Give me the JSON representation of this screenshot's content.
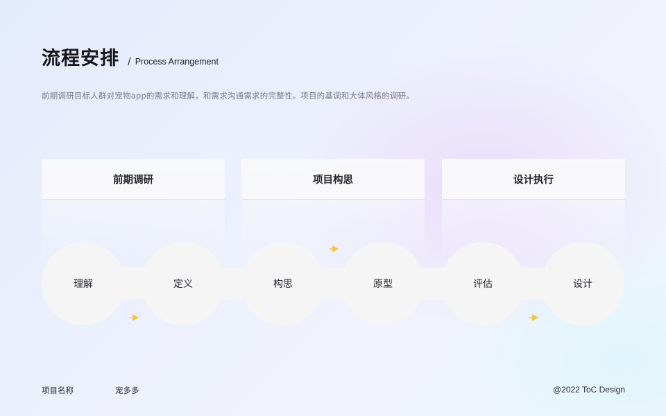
{
  "header": {
    "title": "流程安排",
    "separator": "/",
    "subtitle": "Process Arrangement",
    "description": "前期调研目标人群对宠物app的需求和理解，和需求沟通需求的完整性。项目的基调和大体风格的调研。"
  },
  "phases": [
    {
      "label": "前期调研"
    },
    {
      "label": "项目构思"
    },
    {
      "label": "设计执行"
    }
  ],
  "steps": [
    {
      "label": "理解"
    },
    {
      "label": "定义"
    },
    {
      "label": "构思"
    },
    {
      "label": "原型"
    },
    {
      "label": "评估"
    },
    {
      "label": "设计"
    }
  ],
  "footer": {
    "project_label": "项目名称",
    "project_name": "宠多多",
    "copyright": "@2022 ToC Design"
  },
  "colors": {
    "arrow": "#f6c244",
    "node": "#f5f5f6"
  },
  "icons": {
    "arrow": "arrow-right-icon"
  }
}
